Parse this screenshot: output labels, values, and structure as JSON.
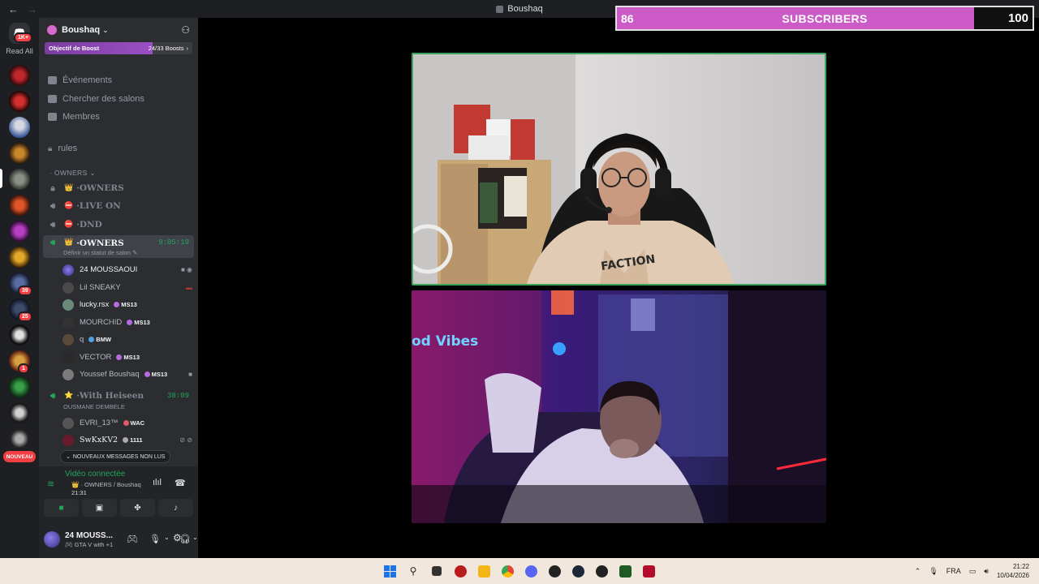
{
  "window": {
    "title": "Boushaq"
  },
  "rail": {
    "home_badge": "1K+",
    "read_all": "Read All",
    "server_badges": [
      "39",
      "25",
      "1"
    ],
    "new_label": "NOUVEAU"
  },
  "sidebar": {
    "server_name": "Boushaq",
    "boost": {
      "label": "Objectif de Boost",
      "value": "24/33 Boosts",
      "progress": 0.73
    },
    "nav": [
      "Événements",
      "Chercher des salons",
      "Membres"
    ],
    "rules_channel": "rules",
    "category": "OWNERS",
    "channels": [
      {
        "name": "OWNERS",
        "emoji": "👑",
        "locked": true
      },
      {
        "name": "LIVE ON",
        "emoji": "⛔"
      },
      {
        "name": "DND",
        "emoji": "⛔"
      }
    ],
    "active_channel": {
      "name": "OWNERS",
      "emoji": "👑",
      "timer": "9:05:19",
      "status": "Définir un statut de salon"
    },
    "active_users": [
      {
        "name": "24 MOUSSAOUI",
        "bold": true,
        "tag": ""
      },
      {
        "name": "Lil SNEAKY",
        "bold": false,
        "tag": ""
      },
      {
        "name": "lucky.rsx",
        "bold": true,
        "tag": "MS13"
      },
      {
        "name": "MOURCHID",
        "bold": false,
        "tag": "MS13"
      },
      {
        "name": "q",
        "bold": false,
        "tag": "BMW"
      },
      {
        "name": "VECTOR",
        "bold": false,
        "tag": "MS13"
      },
      {
        "name": "Youssef Boushaq",
        "bold": false,
        "tag": "MS13"
      }
    ],
    "second_channel": {
      "name": "With Heiseen",
      "emoji": "⭐",
      "timer": "38:09",
      "status": "OUSMANE DEMBELE"
    },
    "second_users": [
      {
        "name": "EVRI_13™",
        "tag": "WAC"
      },
      {
        "name": "SwKxKV2",
        "tag": "1111"
      }
    ],
    "new_messages": "NOUVEAUX MESSAGES NON LUS"
  },
  "voice_panel": {
    "status": "Vidéo connectée",
    "channel": "OWNERS / Boushaq",
    "time": "21:31"
  },
  "user_panel": {
    "name": "24 MOUSS...",
    "status": "GTA V with +1"
  },
  "overlay": {
    "current": "86",
    "label": "SUBSCRIBERS",
    "goal": "100",
    "progress": 0.86
  },
  "taskbar": {
    "lang": "FRA",
    "time": "21:22",
    "date": "10/04/2026"
  }
}
